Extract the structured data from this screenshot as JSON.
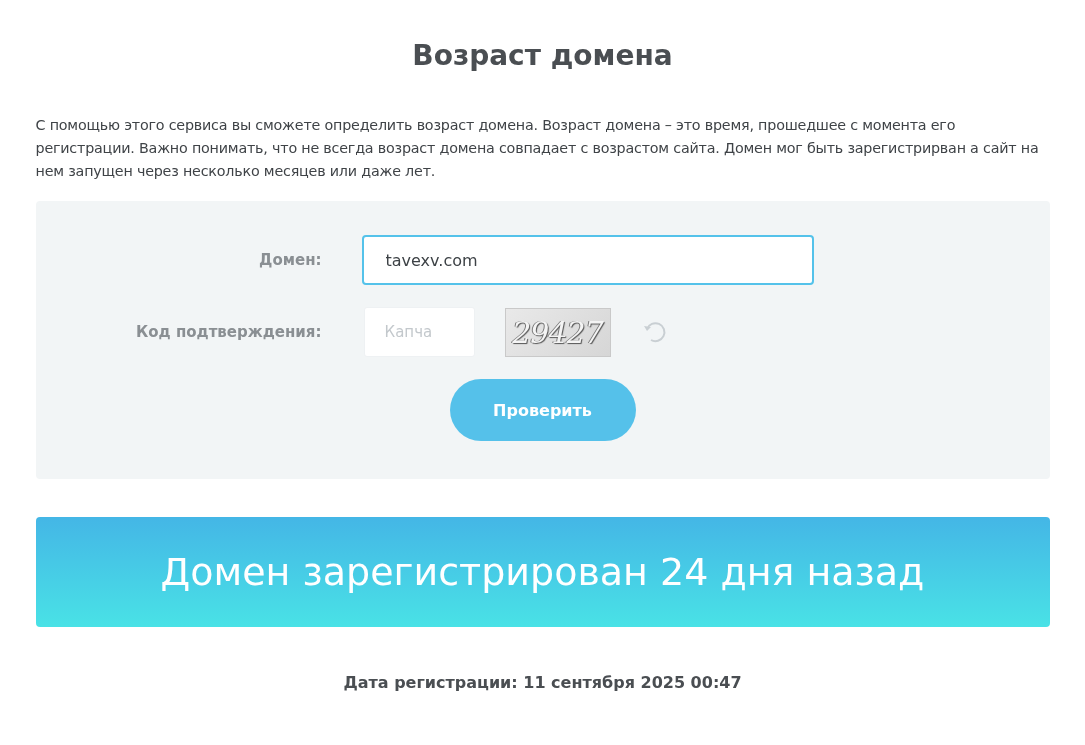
{
  "title": "Возраст домена",
  "description": "С помощью этого сервиса вы сможете определить возраст домена. Возраст домена – это время, прошедшее с момента его регистрации. Важно понимать, что не всегда возраст домена совпадает с возрастом сайта. Домен мог быть зарегистрирван а сайт на нем запущен через несколько месяцев или даже лет.",
  "form": {
    "domain": {
      "label": "Домен:",
      "value": "tavexv.com",
      "focused": true
    },
    "captcha": {
      "label": "Код подтверждения:",
      "placeholder": "Капча",
      "code": "29427"
    },
    "submit": "Проверить"
  },
  "result": "Домен зарегистрирован 24 дня назад",
  "registration_date": "Дата регистрации: 11 сентября 2025 00:47"
}
